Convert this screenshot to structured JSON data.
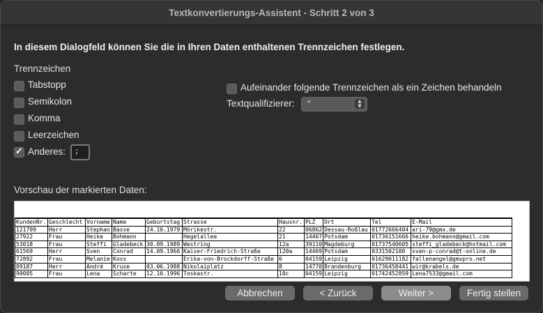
{
  "window": {
    "title": "Textkonvertierungs-Assistent - Schritt 2 von 3"
  },
  "intro_text": "In diesem Dialogfeld können Sie die in Ihren Daten enthaltenen Trennzeichen festlegen.",
  "delimiters": {
    "section_label": "Trennzeichen",
    "tab": {
      "label": "Tabstopp",
      "checked": false
    },
    "semicolon": {
      "label": "Semikolon",
      "checked": false
    },
    "comma": {
      "label": "Komma",
      "checked": false
    },
    "space": {
      "label": "Leerzeichen",
      "checked": false
    },
    "other": {
      "label": "Anderes:",
      "checked": true,
      "value": ";"
    }
  },
  "options": {
    "consecutive": {
      "label": "Aufeinander folgende Trennzeichen als ein Zeichen behandeln",
      "checked": false
    },
    "qualifier_label": "Textqualifizierer:",
    "qualifier_value": "\""
  },
  "preview": {
    "label": "Vorschau der markierten Daten:",
    "columns": [
      "KundenNr.",
      "Geschlecht",
      "Vorname",
      "Name",
      "Geburtstag",
      "Strasse",
      "Hausnr.",
      "PLZ",
      "Ort",
      "Tel",
      "E-Mail"
    ],
    "rows": [
      [
        "121799",
        "Herr",
        "Stephan",
        "Basse",
        "24.10.1979",
        "Mörikestr.",
        "22",
        "06862",
        "Dessau-Roßlau",
        "01772666404",
        "ari-79@gmx.de"
      ],
      [
        "27922",
        "Frau",
        "Heike",
        "Bohmann",
        "",
        "Hegelallee",
        "21",
        "14467",
        "Potsdam",
        "01736151666",
        "heike.bohmann@gmail.com"
      ],
      [
        "53018",
        "Frau",
        "Steffi",
        "Gladebeck",
        "30.09.1989",
        "Westring",
        "12a",
        "39110",
        "Magdeburg",
        "01737540605",
        "steffi_gladebeck@hotmail.com"
      ],
      [
        "61569",
        "Herr",
        "Sven",
        "Conrad",
        "14.09.1966",
        "Kaiser-Friedrich-Straße",
        "120a",
        "14469",
        "Potsdam",
        "0331502100",
        "sven-p-conrad@t-online.de"
      ],
      [
        "72892",
        "Frau",
        "Melanie",
        "Koss",
        "",
        "Erika-von-Brockdorff-Straße",
        "6",
        "04159",
        "Leipzig",
        "01629011182",
        "fallenangel@gmxpro.net"
      ],
      [
        "89187",
        "Herr",
        "André",
        "Kruse",
        "03.06.1988",
        "Nikolaiplatz",
        "8",
        "14770",
        "Brandenburg",
        "01736458441",
        "wir@krabels.de"
      ],
      [
        "90085",
        "Frau",
        "Lena",
        "Scharte",
        "12.10.1996",
        "Toskastr.",
        "10c",
        "04159",
        "Leipzig",
        "01742452859",
        "Lena7533@gmail.com"
      ]
    ]
  },
  "buttons": {
    "cancel": "Abbrechen",
    "back": "< Zurück",
    "next": "Weiter >",
    "finish": "Fertig stellen"
  }
}
